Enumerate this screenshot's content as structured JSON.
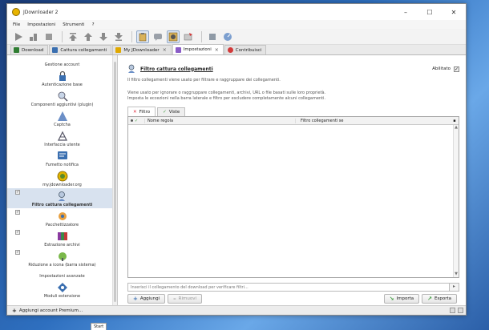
{
  "window": {
    "title": "JDownloader 2",
    "controls": {
      "minimize": "–",
      "maximize": "☐",
      "close": "✕"
    }
  },
  "menu": [
    "File",
    "Impostazioni",
    "Strumenti",
    "?"
  ],
  "tabs": [
    {
      "label": "Download",
      "icon": "download-icon",
      "color": "#2f7d32",
      "active": false,
      "closable": false
    },
    {
      "label": "Cattura collegamenti",
      "icon": "link-grabber-icon",
      "color": "#3a6fb0",
      "active": false,
      "closable": false
    },
    {
      "label": "My JDownloader",
      "icon": "my-jdownloader-icon",
      "color": "#e0a800",
      "active": false,
      "closable": true
    },
    {
      "label": "Impostazioni",
      "icon": "settings-icon",
      "color": "#8a5cc7",
      "active": true,
      "closable": true
    },
    {
      "label": "Contribuisci",
      "icon": "heart-icon",
      "color": "#d23a3a",
      "active": false,
      "closable": false
    }
  ],
  "sidebar": {
    "items": [
      {
        "label": "Gestione account",
        "checkbox": false,
        "icon": "account-icon",
        "selected": false
      },
      {
        "label": "Autenticazione base",
        "checkbox": false,
        "icon": "lock-icon",
        "selected": false
      },
      {
        "label": "Componenti aggiuntivi (plugin)",
        "checkbox": false,
        "icon": "plugin-icon",
        "selected": false
      },
      {
        "label": "Captcha",
        "checkbox": false,
        "icon": "captcha-icon",
        "selected": false
      },
      {
        "label": "Interfaccia utente",
        "checkbox": false,
        "icon": "ui-icon",
        "selected": false
      },
      {
        "label": "Fumetto notifica",
        "checkbox": false,
        "icon": "balloon-icon",
        "selected": false
      },
      {
        "label": "my.jdownloader.org",
        "checkbox": false,
        "icon": "myjd-icon",
        "selected": false
      },
      {
        "label": "Filtro cattura collegamenti",
        "checkbox": true,
        "icon": "filter-icon",
        "selected": true
      },
      {
        "label": "Pacchettizzatore",
        "checkbox": true,
        "icon": "packagizer-icon",
        "selected": false
      },
      {
        "label": "Estrazione archivi",
        "checkbox": true,
        "icon": "archive-icon",
        "selected": false
      },
      {
        "label": "Riduzione a icona (barra sistema)",
        "checkbox": true,
        "icon": "tray-icon",
        "selected": false
      },
      {
        "label": "Impostazioni avanzate",
        "checkbox": false,
        "icon": "advanced-icon",
        "selected": false
      },
      {
        "label": "Moduli estensione",
        "checkbox": false,
        "icon": "extension-icon",
        "selected": false
      }
    ]
  },
  "panel": {
    "title": "Filtro cattura collegamenti",
    "enabled_label": "Abilitato",
    "enabled_check": "✓",
    "description1": "Il filtro collegamenti viene usato per filtrare e raggruppare dei collegamenti.",
    "description2a": "Viene usato per ignorare o raggruppare collegamenti, archivi, URL o file basati sulle loro proprietà.",
    "description2b": "Imposta le eccezioni nella barra laterale e filtro per escludere completamente alcuni collegamenti.",
    "subtabs": [
      {
        "label": "Filtro",
        "mark": "✕",
        "active": true
      },
      {
        "label": "Viste",
        "mark": "✓",
        "active": false
      }
    ],
    "table": {
      "columns": [
        "Nome regola",
        "Filtro collegamenti se"
      ]
    },
    "test_placeholder": "Inserisci il collegamento del download per verificare filtri...",
    "buttons": {
      "add": "Aggiungi",
      "remove": "Rimuovi",
      "import": "Importa",
      "export": "Esporta"
    }
  },
  "statusbar": {
    "text": "Aggiungi account Premium..."
  },
  "taskbar": {
    "start_tooltip": "Start"
  }
}
